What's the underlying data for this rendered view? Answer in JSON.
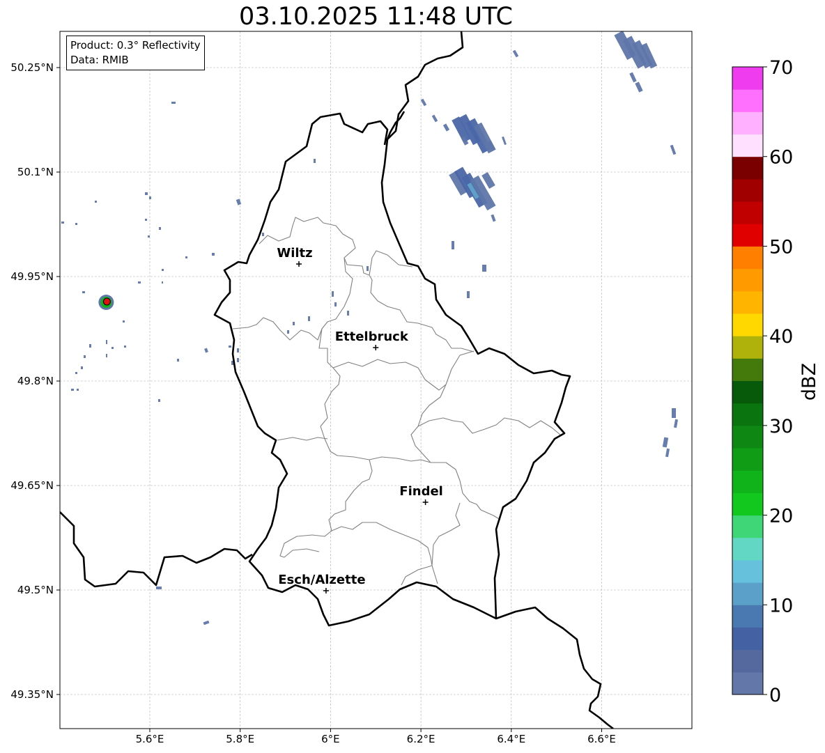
{
  "title": "03.10.2025 11:48 UTC",
  "info_box": {
    "product": "Product: 0.3° Reflectivity",
    "data": "Data: RMIB"
  },
  "map": {
    "lon_range": [
      5.4,
      6.8
    ],
    "lat_range": [
      49.3,
      50.3
    ],
    "lon_ticks": [
      {
        "value": 5.6,
        "label": "5.6°E"
      },
      {
        "value": 5.8,
        "label": "5.8°E"
      },
      {
        "value": 6.0,
        "label": "6°E"
      },
      {
        "value": 6.2,
        "label": "6.2°E"
      },
      {
        "value": 6.4,
        "label": "6.4°E"
      },
      {
        "value": 6.6,
        "label": "6.6°E"
      }
    ],
    "lat_ticks": [
      {
        "value": 49.35,
        "label": "49.35°N"
      },
      {
        "value": 49.5,
        "label": "49.5°N"
      },
      {
        "value": 49.65,
        "label": "49.65°N"
      },
      {
        "value": 49.8,
        "label": "49.8°N"
      },
      {
        "value": 49.95,
        "label": "49.95°N"
      },
      {
        "value": 50.1,
        "label": "50.1°N"
      },
      {
        "value": 50.25,
        "label": "50.25°N"
      }
    ],
    "grid": true,
    "cities": [
      {
        "name": "Wiltz",
        "lon": 5.93,
        "lat": 49.968
      },
      {
        "name": "Ettelbruck",
        "lon": 6.1,
        "lat": 49.848
      },
      {
        "name": "Findel",
        "lon": 6.21,
        "lat": 49.626
      },
      {
        "name": "Esch/Alzette",
        "lon": 5.99,
        "lat": 49.499
      }
    ],
    "radar_site": {
      "lon": 5.505,
      "lat": 49.914,
      "color": "#e01010"
    },
    "colors": {
      "border": "#000000",
      "cantons": "#808080",
      "grid": "#b0b0b0",
      "echo_weak": "#5e76aa",
      "echo_mid": "#4a66a6",
      "echo_cyan": "#5fa3c8",
      "echo_green": "#12b41e"
    }
  },
  "colorbar": {
    "label": "dBZ",
    "min": 0,
    "max": 70,
    "step": 2.5,
    "ticks": [
      {
        "value": 0,
        "label": "0"
      },
      {
        "value": 10,
        "label": "10"
      },
      {
        "value": 20,
        "label": "20"
      },
      {
        "value": 30,
        "label": "30"
      },
      {
        "value": 40,
        "label": "40"
      },
      {
        "value": 50,
        "label": "50"
      },
      {
        "value": 60,
        "label": "60"
      },
      {
        "value": 70,
        "label": "70"
      }
    ],
    "colors": [
      "#6477a9",
      "#55699f",
      "#4461a3",
      "#4a78b0",
      "#5ba0c8",
      "#66c1dc",
      "#62d8c4",
      "#3ed676",
      "#12c81e",
      "#10b41a",
      "#109c14",
      "#0e8812",
      "#0a740e",
      "#075a0a",
      "#447a0c",
      "#aeb20a",
      "#ffd800",
      "#ffb500",
      "#ff9a00",
      "#ff7f00",
      "#e00000",
      "#c00000",
      "#a00000",
      "#7a0000",
      "#ffe0ff",
      "#ffb0ff",
      "#ff70ff",
      "#ee3cee"
    ]
  }
}
